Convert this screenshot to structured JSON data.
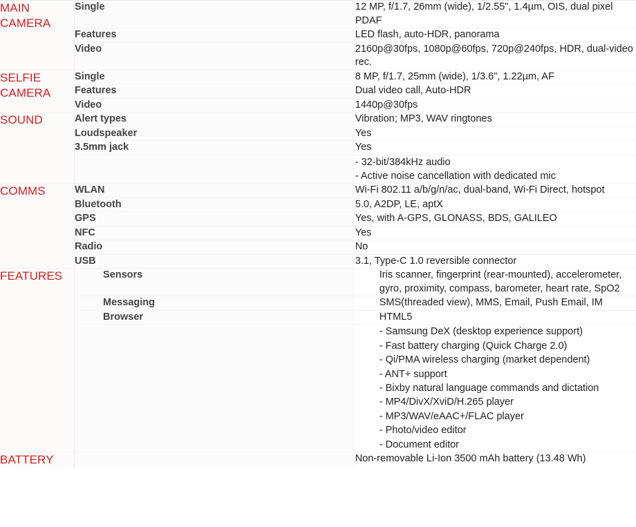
{
  "colors": {
    "section_header": "#cc2222",
    "label": "#444444",
    "value": "#222222",
    "row_rule": "#f4f4f4",
    "section_rule": "#e6e6e6",
    "left_col_bg": "#fdfafa"
  },
  "sections": [
    {
      "id": "main-camera",
      "title": "MAIN\nCAMERA",
      "rows": [
        {
          "label": "Single",
          "value": "12 MP, f/1.7, 26mm (wide), 1/2.55\", 1.4µm, OIS, dual pixel PDAF"
        },
        {
          "label": "Features",
          "value": "LED flash, auto-HDR, panorama"
        },
        {
          "label": "Video",
          "value": "2160p@30fps, 1080p@60fps, 720p@240fps, HDR, dual-video rec."
        }
      ]
    },
    {
      "id": "selfie-camera",
      "title": "SELFIE\nCAMERA",
      "rows": [
        {
          "label": "Single",
          "value": "8 MP, f/1.7, 25mm (wide), 1/3.6\", 1.22µm, AF"
        },
        {
          "label": "Features",
          "value": "Dual video call, Auto-HDR"
        },
        {
          "label": "Video",
          "value": "1440p@30fps"
        }
      ]
    },
    {
      "id": "sound",
      "title": "SOUND",
      "rows": [
        {
          "label": "Alert types",
          "value": "Vibration; MP3, WAV ringtones"
        },
        {
          "label": "Loudspeaker",
          "value": "Yes"
        },
        {
          "label": "3.5mm jack",
          "value": "Yes"
        },
        {
          "label": "",
          "value": "- 32-bit/384kHz audio\n- Active noise cancellation with dedicated mic"
        }
      ]
    },
    {
      "id": "comms",
      "title": "COMMS",
      "rows": [
        {
          "label": "WLAN",
          "value": "Wi-Fi 802.11 a/b/g/n/ac, dual-band, Wi-Fi Direct, hotspot"
        },
        {
          "label": "Bluetooth",
          "value": "5.0, A2DP, LE, aptX"
        },
        {
          "label": "GPS",
          "value": "Yes, with A-GPS, GLONASS, BDS, GALILEO"
        },
        {
          "label": "NFC",
          "value": "Yes"
        },
        {
          "label": "Radio",
          "value": "No"
        },
        {
          "label": "USB",
          "value": "3.1, Type-C 1.0 reversible connector"
        }
      ]
    },
    {
      "id": "features",
      "title": "FEATURES",
      "indented": true,
      "rows": [
        {
          "label": "Sensors",
          "value": "Iris scanner, fingerprint (rear-mounted), accelerometer, gyro, proximity, compass, barometer, heart rate, SpO2"
        },
        {
          "label": "Messaging",
          "value": "SMS(threaded view), MMS, Email, Push Email, IM"
        },
        {
          "label": "Browser",
          "value": "HTML5"
        },
        {
          "label": "",
          "value": "- Samsung DeX (desktop experience support)\n- Fast battery charging (Quick Charge 2.0)\n- Qi/PMA wireless charging (market dependent)\n- ANT+ support\n- Bixby natural language commands and dictation\n- MP4/DivX/XviD/H.265 player\n- MP3/WAV/eAAC+/FLAC player\n- Photo/video editor\n- Document editor"
        }
      ]
    },
    {
      "id": "battery",
      "title": "BATTERY",
      "rows": [
        {
          "label": "",
          "value": "Non-removable Li-Ion 3500 mAh battery (13.48 Wh)"
        }
      ]
    }
  ]
}
